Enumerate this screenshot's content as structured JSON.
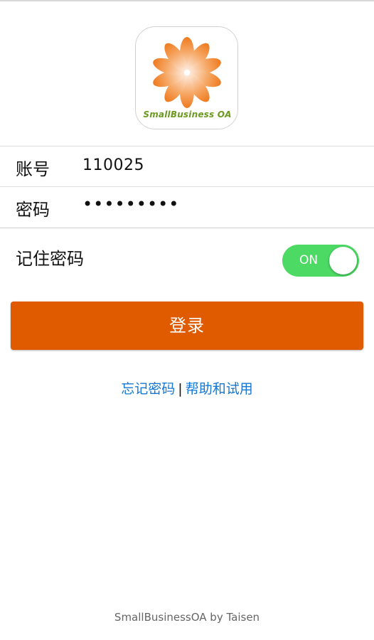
{
  "logo": {
    "text": "SmallBusiness OA"
  },
  "form": {
    "account_label": "账号",
    "account_value": "110025",
    "password_label": "密码",
    "password_value": "•••••••••"
  },
  "remember": {
    "label": "记住密码",
    "toggle_text": "ON",
    "toggle_on": true,
    "toggle_color": "#4cd964"
  },
  "login_button": {
    "label": "登录",
    "color": "#e05a00"
  },
  "links": {
    "forgot_password": "忘记密码",
    "separator": "|",
    "help_trial": "帮助和试用",
    "color": "#1677d2"
  },
  "footer": {
    "text": "SmallBusinessOA by Taisen"
  }
}
